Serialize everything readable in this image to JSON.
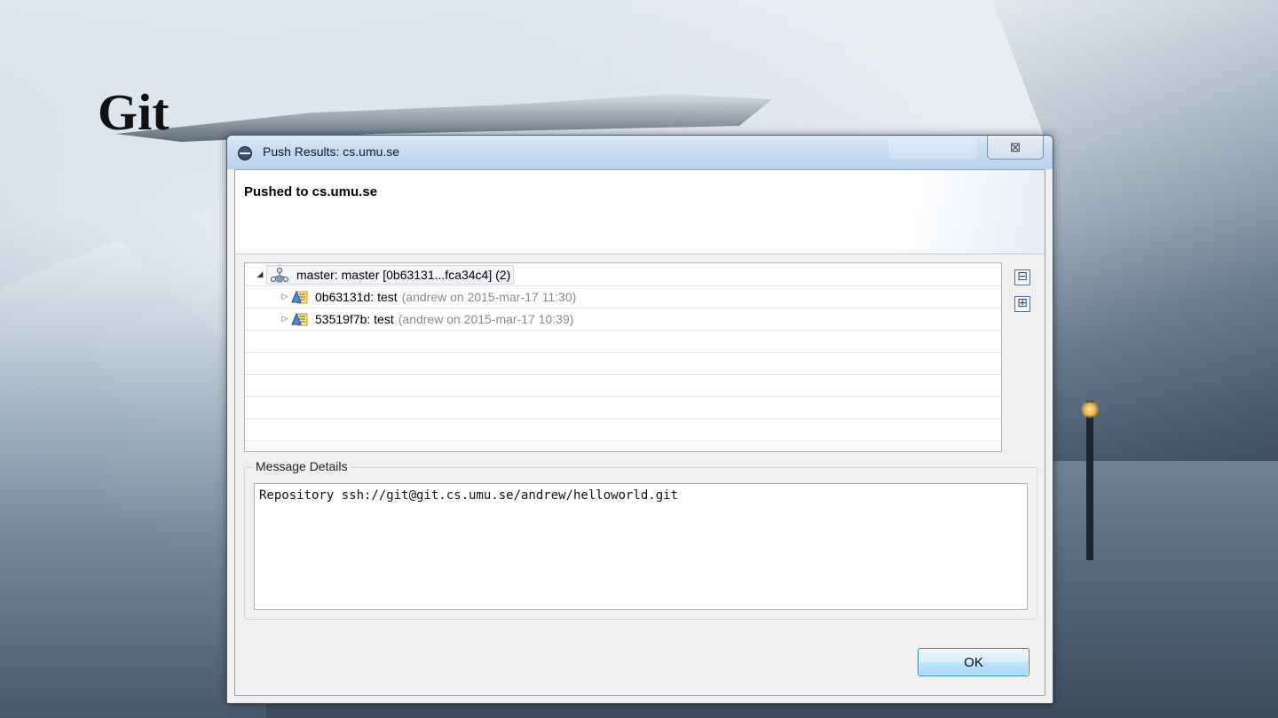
{
  "slide": {
    "title": "Git"
  },
  "dialog": {
    "window_title": "Push Results: cs.umu.se",
    "close_glyph": "⊠",
    "header_title": "Pushed to cs.umu.se",
    "tree": {
      "root": {
        "label": "master: master [0b63131...fca34c4] (2)",
        "icon": "repository-icon",
        "expanded": true
      },
      "commits": [
        {
          "id_msg": "0b63131d: test",
          "meta": "(andrew on 2015-mar-17 11:30)",
          "icon": "commit-icon",
          "expanded": false
        },
        {
          "id_msg": "53519f7b: test",
          "meta": "(andrew on 2015-mar-17 10:39)",
          "icon": "commit-icon",
          "expanded": false
        }
      ],
      "collapse_all_glyph": "⊟",
      "expand_all_glyph": "⊞"
    },
    "message_group_label": "Message Details",
    "message_text": "Repository ssh://git@git.cs.umu.se/andrew/helloworld.git",
    "ok_label": "OK"
  },
  "colors": {
    "titlebar": "#c4daf0",
    "ok_button_border": "#3c7fb1",
    "meta_text": "#8a8a8a"
  }
}
